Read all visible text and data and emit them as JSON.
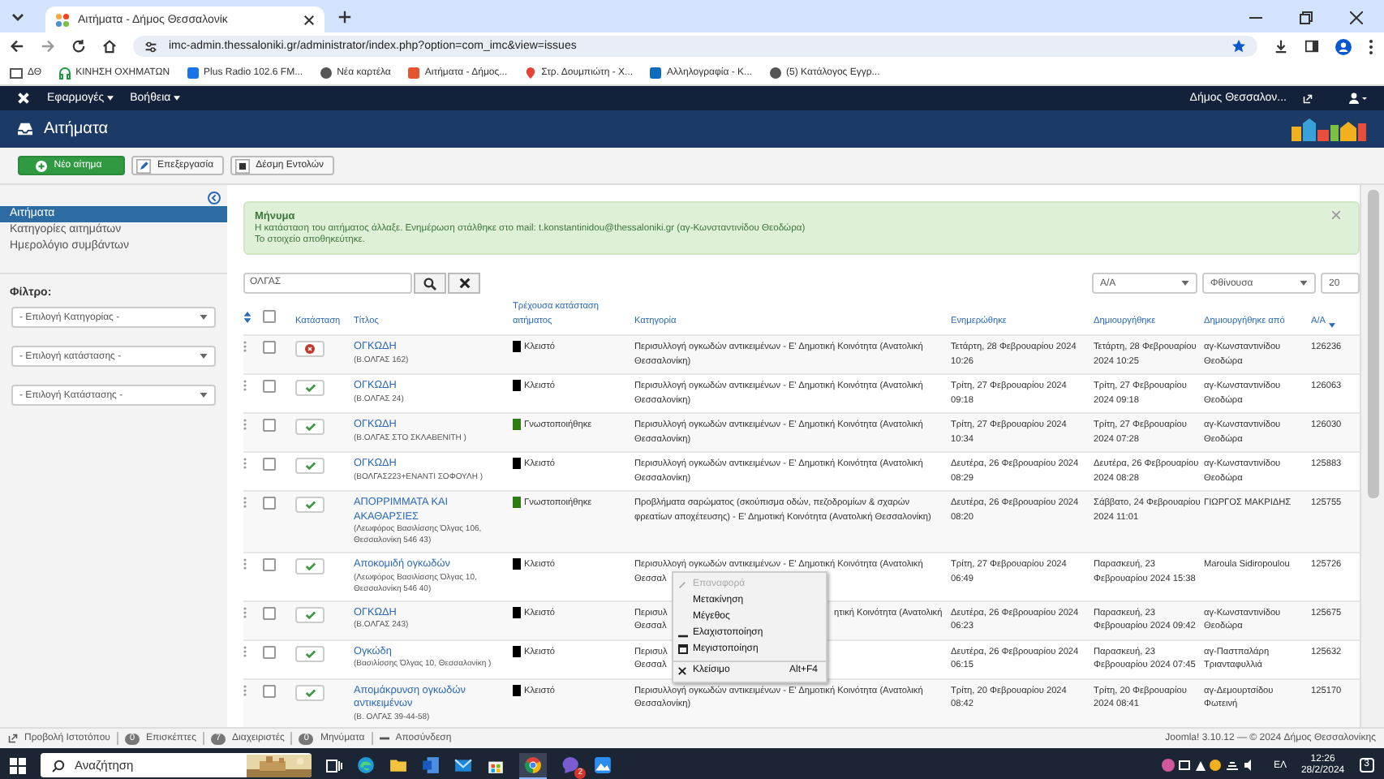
{
  "browser": {
    "tab_title": "Αιτήματα - Δήμος Θεσσαλονίκ",
    "url": "imc-admin.thessaloniki.gr/administrator/index.php?option=com_imc&view=issues",
    "bookmarks": [
      {
        "label": "ΔΘ",
        "kind": "folder"
      },
      {
        "label": "ΚΙΝΗΣΗ ΟΧΗΜΑΤΩΝ",
        "kind": "headset"
      },
      {
        "label": "Plus Radio 102.6 FM...",
        "kind": "play"
      },
      {
        "label": "Νέα καρτέλα",
        "kind": "globe"
      },
      {
        "label": "Αιτήματα - Δήμος...",
        "kind": "joomla"
      },
      {
        "label": "Στρ. Δουμπιώτη - Χ...",
        "kind": "pin"
      },
      {
        "label": "Αλληλογραφία - Κ...",
        "kind": "mail"
      },
      {
        "label": "(5) Κατάλογος Εγγρ...",
        "kind": "globe"
      }
    ]
  },
  "nav": {
    "menus": [
      "Εφαρμογές",
      "Βοήθεια"
    ],
    "site": "Δήμος Θεσσαλον..."
  },
  "header": {
    "title": "Αιτήματα"
  },
  "toolbar": [
    {
      "label": "Νέο αίτημα",
      "kind": "new"
    },
    {
      "label": "Επεξεργασία",
      "kind": "edit"
    },
    {
      "label": "Δέσμη Εντολών",
      "kind": "batch"
    }
  ],
  "sidebar": {
    "items": [
      {
        "label": "Αιτήματα",
        "selected": true
      },
      {
        "label": "Κατηγορίες αιτημάτων",
        "selected": false
      },
      {
        "label": "Ημερολόγιο συμβάντων",
        "selected": false
      }
    ],
    "filter_label": "Φίλτρο:",
    "filters": [
      "- Επιλογή Κατηγορίας -",
      "- Επιλογή κατάστασης -",
      "- Επιλογή Κατάστασης -"
    ]
  },
  "message": {
    "heading": "Μήνυμα",
    "lines": [
      "Η κατάσταση του αιτήματος άλλαξε. Ενημέρωση στάλθηκε στο mail: t.konstantinidou@thessaloniki.gr (αγ-Κωνσταντινίδου Θεοδώρα)",
      "Το στοιχείο αποθηκεύτηκε."
    ]
  },
  "search": {
    "value": "ΟΛΓΑΣ"
  },
  "list_options": [
    "Α/Α",
    "Φθίνουσα",
    "20"
  ],
  "table": {
    "columns": [
      {
        "label": "Κατάσταση",
        "sorted": false
      },
      {
        "label": "Τίτλος",
        "sorted": false
      },
      {
        "label": "Τρέχουσα κατάσταση αιτήματος",
        "sorted": false
      },
      {
        "label": "Κατηγορία",
        "sorted": false
      },
      {
        "label": "Ενημερώθηκε",
        "sorted": false
      },
      {
        "label": "Δημιουργήθηκε",
        "sorted": false
      },
      {
        "label": "Δημιουργήθηκε από",
        "sorted": false
      },
      {
        "label": "Α/Α",
        "sorted": true
      }
    ],
    "select_all_checked": false,
    "rows": [
      {
        "checked": false,
        "published": false,
        "title": "ΟΓΚΩΔΗ",
        "address": "(Β.ΟΛΓΑΣ 162)",
        "state": "Κλειστό",
        "color": "#000000",
        "category": "Περισυλλογή ογκωδών αντικειμένων - Ε' Δημοτική Κοινότητα (Ανατολική Θεσσαλονίκη)",
        "updated": "Τετάρτη, 28 Φεβρουαρίου 2024 10:26",
        "created": "Τετάρτη, 28 Φεβρουαρίου 2024 10:25",
        "author": "αγ-Κωνσταντινίδου Θεοδώρα",
        "id": "126236"
      },
      {
        "checked": false,
        "published": true,
        "title": "ΟΓΚΩΔΗ",
        "address": "(Β.ΟΛΓΑΣ 24)",
        "state": "Κλειστό",
        "color": "#000000",
        "category": "Περισυλλογή ογκωδών αντικειμένων - Ε' Δημοτική Κοινότητα (Ανατολική Θεσσαλονίκη)",
        "updated": "Τρίτη, 27 Φεβρουαρίου 2024 09:18",
        "created": "Τρίτη, 27 Φεβρουαρίου 2024 09:18",
        "author": "αγ-Κωνσταντινίδου Θεοδώρα",
        "id": "126063"
      },
      {
        "checked": false,
        "published": true,
        "title": "ΟΓΚΩΔΗ",
        "address": "(Β.ΟΛΓΑΣ ΣΤΟ ΣΚΛΑΒΕΝΙΤΗ )",
        "state": "Γνωστοποιήθηκε",
        "color": "#2e7d12",
        "category": "Περισυλλογή ογκωδών αντικειμένων - Ε' Δημοτική Κοινότητα (Ανατολική Θεσσαλονίκη)",
        "updated": "Τρίτη, 27 Φεβρουαρίου 2024 10:34",
        "created": "Τρίτη, 27 Φεβρουαρίου 2024 07:28",
        "author": "αγ-Κωνσταντινίδου Θεοδώρα",
        "id": "126030"
      },
      {
        "checked": false,
        "published": true,
        "title": "ΟΓΚΩΔΗ",
        "address": "(ΒΟΛΓΑΣ223+ΕΝΑΝΤΙ ΣΟΦΟΥΛΗ )",
        "state": "Κλειστό",
        "color": "#000000",
        "category": "Περισυλλογή ογκωδών αντικειμένων - Ε' Δημοτική Κοινότητα (Ανατολική Θεσσαλονίκη)",
        "updated": "Δευτέρα, 26 Φεβρουαρίου 2024 08:29",
        "created": "Δευτέρα, 26 Φεβρουαρίου 2024 08:28",
        "author": "αγ-Κωνσταντινίδου Θεοδώρα",
        "id": "125883"
      },
      {
        "checked": false,
        "published": true,
        "title": "ΑΠΟΡΡΙΜΜΑΤΑ ΚΑΙ ΑΚΑΘΑΡΣΙΕΣ",
        "address": "(Λεωφόρος Βασιλίσσης Όλγας 106, Θεσσαλονίκη 546 43)",
        "state": "Γνωστοποιήθηκε",
        "color": "#2e7d12",
        "category": "Προβλήματα σαρώματος (σκούπισμα οδών, πεζοδρομίων & σχαρών φρεατίων αποχέτευσης) - Ε' Δημοτική Κοινότητα (Ανατολική Θεσσαλονίκη)",
        "updated": "Δευτέρα, 26 Φεβρουαρίου 2024 08:20",
        "created": "Σάββατο, 24 Φεβρουαρίου 2024 11:01",
        "author": "ΓΙΩΡΓΟΣ ΜΑΚΡΙΔΗΣ",
        "id": "125755"
      },
      {
        "checked": false,
        "published": true,
        "title": "Αποκομιδή ογκωδών",
        "address": "(Λεωφόρος Βασιλίσσης Όλγας 10, Θεσσαλονίκη 546 40)",
        "state": "Κλειστό",
        "color": "#000000",
        "category_lines": [
          {
            "left": "Περισυλλογή ογκωδών αντικειμένων - Ε' Δημοτική Κοινότητα (Ανατολική"
          },
          {
            "left": "Θεσσαλ"
          }
        ],
        "updated": "Τρίτη, 27 Φεβρουαρίου 2024 06:49",
        "created": "Παρασκευή, 23 Φεβρουαρίου 2024 15:38",
        "author": "Maroula Sidiropoulou",
        "id": "125726",
        "context_menu": {
          "items": [
            {
              "label": "Επαναφορά",
              "kind": "restore",
              "disabled": true
            },
            {
              "label": "Μετακίνηση",
              "kind": "plain",
              "disabled": false
            },
            {
              "label": "Μέγεθος",
              "kind": "plain",
              "disabled": false
            },
            {
              "label": "Ελαχιστοποίηση",
              "kind": "minimize",
              "disabled": false
            },
            {
              "label": "Μεγιστοποίηση",
              "kind": "maximize",
              "disabled": false
            },
            {
              "label": "Κλείσιμο",
              "kind": "close",
              "disabled": false,
              "shortcut": "Alt+F4"
            }
          ]
        }
      },
      {
        "checked": false,
        "published": true,
        "title": "ΟΓΚΩΔΗ",
        "address": "(Β.ΟΛΓΑΣ 243)",
        "state": "Κλειστό",
        "color": "#000000",
        "category_lines": [
          {
            "left": "Περισυλ",
            "right": "ητική Κοινότητα (Ανατολική"
          },
          {
            "left": "Θεσσαλ"
          }
        ],
        "updated": "Δευτέρα, 26 Φεβρουαρίου 2024 06:23",
        "created": "Παρασκευή, 23 Φεβρουαρίου 2024 09:42",
        "author": "αγ-Κωνσταντινίδου Θεοδώρα",
        "id": "125675"
      },
      {
        "checked": false,
        "published": true,
        "title": "Ογκώδη",
        "address": "(Βασιλίσσης Όλγας 10, Θεσσαλονίκη )",
        "state": "Κλειστό",
        "color": "#000000",
        "category_lines": [
          {
            "left": "Περισυλ"
          },
          {
            "left": "Θεσσαλ"
          }
        ],
        "updated": "Δευτέρα, 26 Φεβρουαρίου 2024 06:15",
        "created": "Παρασκευή, 23 Φεβρουαρίου 2024 07:45",
        "author": "αγ-Παστπαλάρη Τριανταφυλλιά",
        "id": "125632"
      },
      {
        "checked": false,
        "published": true,
        "title": "Απομάκρυνση ογκωδών αντικειμένων",
        "address": "(Β. ΟΛΓΑΣ 39-44-58)",
        "state": "Κλειστό",
        "color": "#000000",
        "category": "Περισυλλογή ογκωδών αντικειμένων - Ε' Δημοτική Κοινότητα (Ανατολική Θεσσαλονίκη)",
        "updated": "Τρίτη, 20 Φεβρουαρίου 2024 08:42",
        "created": "Τρίτη, 20 Φεβρουαρίου 2024 08:41",
        "author": "αγ-Δεμουρτσίδου Φωτεινή",
        "id": "125170"
      }
    ]
  },
  "status_bar": {
    "view_site": "Προβολή Ιστοτόπου",
    "counters": [
      {
        "count": "0",
        "label": "Επισκέπτες"
      },
      {
        "count": "7",
        "label": "Διαχειριστές"
      },
      {
        "count": "0",
        "label": "Μηνύματα"
      }
    ],
    "logout": "Αποσύνδεση",
    "version": "Joomla! 3.10.12 — © 2024 Δήμος Θεσσαλονίκης"
  },
  "taskbar": {
    "search_placeholder": "Αναζήτηση",
    "app_badge": "2",
    "language": "ΕΛ",
    "time": "12:26",
    "date": "28/2/2024",
    "notifications": "3"
  }
}
